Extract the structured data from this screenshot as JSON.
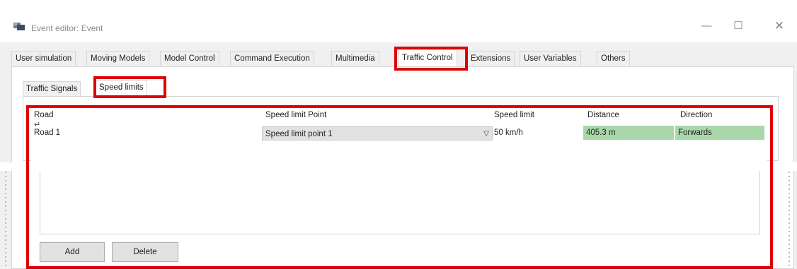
{
  "window": {
    "title": "Event editor: Event",
    "icon": "event-editor-app-icon",
    "controls": {
      "minimize": "—",
      "maximize": "☐",
      "close": "✕"
    }
  },
  "tabs": [
    {
      "label": "User simulation",
      "active": false
    },
    {
      "label": "Moving Models",
      "active": false
    },
    {
      "label": "Model Control",
      "active": false
    },
    {
      "label": "Command Execution",
      "active": false
    },
    {
      "label": "Multimedia",
      "active": false
    },
    {
      "label": "Traffic Control",
      "active": true
    },
    {
      "label": "Extensions",
      "active": false
    },
    {
      "label": "User Variables",
      "active": false
    },
    {
      "label": "Others",
      "active": false
    }
  ],
  "subtabs": [
    {
      "label": "Traffic Signals",
      "active": false
    },
    {
      "label": "Speed limits",
      "active": true
    }
  ],
  "table": {
    "columns": [
      "Road",
      "Speed limit Point",
      "Speed limit",
      "Distance",
      "Direction"
    ],
    "rows": [
      {
        "road": "Road 1",
        "speed_limit_point": "Speed limit point 1",
        "speed_limit": "50 km/h",
        "distance": "405.3 m",
        "direction": "Forwards"
      }
    ]
  },
  "buttons": {
    "add": "Add",
    "delete": "Delete"
  },
  "colors": {
    "highlight": "#e00000",
    "selected_cell": "#a9d7a9"
  }
}
